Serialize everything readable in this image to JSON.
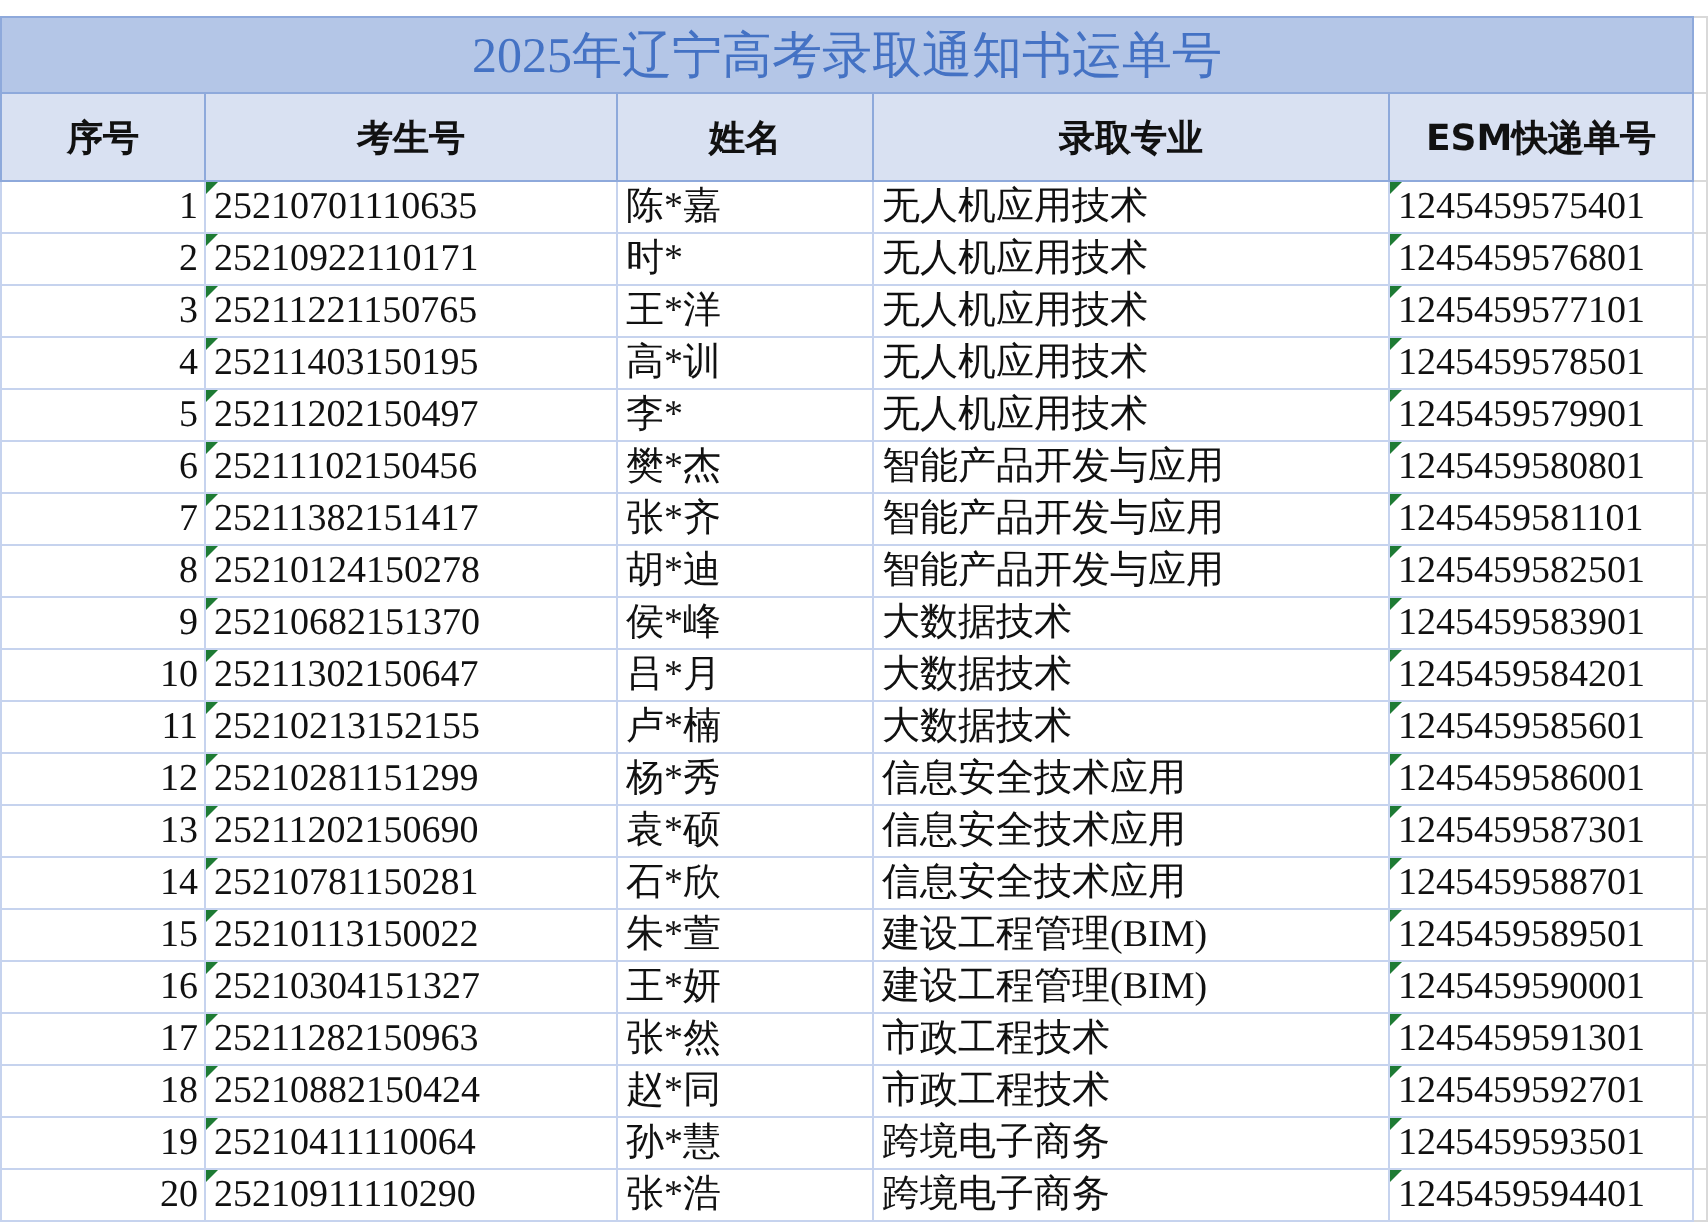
{
  "title": "2025年辽宁高考录取通知书运单号",
  "columns": [
    "序号",
    "考生号",
    "姓名",
    "录取专业",
    "ESM快递单号"
  ],
  "rows": [
    [
      "1",
      "25210701110635",
      "陈*嘉",
      "无人机应用技术",
      "1245459575401"
    ],
    [
      "2",
      "25210922110171",
      "时*",
      "无人机应用技术",
      "1245459576801"
    ],
    [
      "3",
      "25211221150765",
      "王*洋",
      "无人机应用技术",
      "1245459577101"
    ],
    [
      "4",
      "25211403150195",
      "高*训",
      "无人机应用技术",
      "1245459578501"
    ],
    [
      "5",
      "25211202150497",
      "李*",
      "无人机应用技术",
      "1245459579901"
    ],
    [
      "6",
      "25211102150456",
      "樊*杰",
      "智能产品开发与应用",
      "1245459580801"
    ],
    [
      "7",
      "25211382151417",
      "张*齐",
      "智能产品开发与应用",
      "1245459581101"
    ],
    [
      "8",
      "25210124150278",
      "胡*迪",
      "智能产品开发与应用",
      "1245459582501"
    ],
    [
      "9",
      "25210682151370",
      "侯*峰",
      "大数据技术",
      "1245459583901"
    ],
    [
      "10",
      "25211302150647",
      "吕*月",
      "大数据技术",
      "1245459584201"
    ],
    [
      "11",
      "25210213152155",
      "卢*楠",
      "大数据技术",
      "1245459585601"
    ],
    [
      "12",
      "25210281151299",
      "杨*秀",
      "信息安全技术应用",
      "1245459586001"
    ],
    [
      "13",
      "25211202150690",
      "袁*硕",
      "信息安全技术应用",
      "1245459587301"
    ],
    [
      "14",
      "25210781150281",
      "石*欣",
      "信息安全技术应用",
      "1245459588701"
    ],
    [
      "15",
      "25210113150022",
      "朱*萱",
      "建设工程管理(BIM)",
      "1245459589501"
    ],
    [
      "16",
      "25210304151327",
      "王*妍",
      "建设工程管理(BIM)",
      "1245459590001"
    ],
    [
      "17",
      "25211282150963",
      "张*然",
      "市政工程技术",
      "1245459591301"
    ],
    [
      "18",
      "25210882150424",
      "赵*同",
      "市政工程技术",
      "1245459592701"
    ],
    [
      "19",
      "25210411110064",
      "孙*慧",
      "跨境电子商务",
      "1245459593501"
    ],
    [
      "20",
      "25210911110290",
      "张*浩",
      "跨境电子商务",
      "1245459594401"
    ]
  ]
}
